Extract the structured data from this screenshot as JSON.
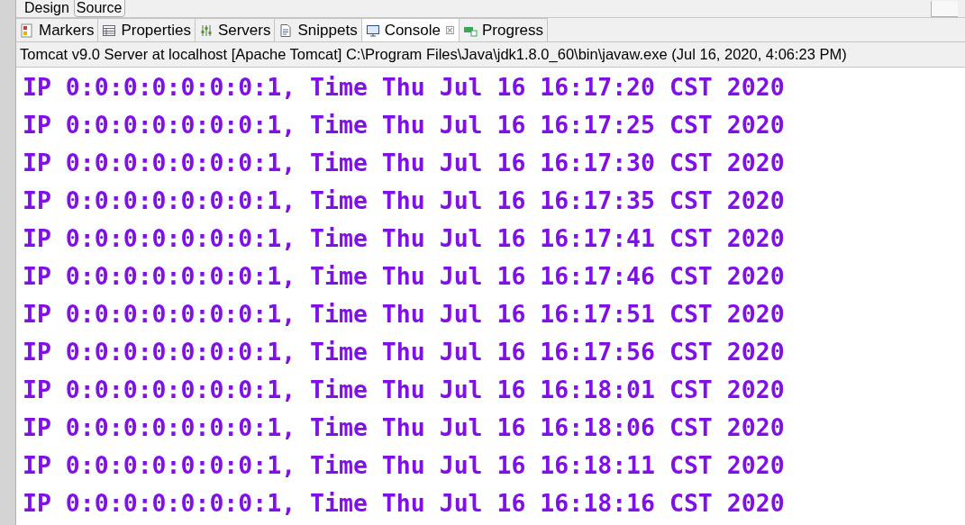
{
  "editor_tabs": [
    {
      "label": "Design",
      "selected": false
    },
    {
      "label": "Source",
      "selected": true
    }
  ],
  "view_tabs": [
    {
      "label": "Markers",
      "selected": false
    },
    {
      "label": "Properties",
      "selected": false
    },
    {
      "label": "Servers",
      "selected": false
    },
    {
      "label": "Snippets",
      "selected": false
    },
    {
      "label": "Console",
      "selected": true,
      "close": "☒"
    },
    {
      "label": "Progress",
      "selected": false
    }
  ],
  "console": {
    "process": "Tomcat v9.0 Server at localhost [Apache Tomcat] C:\\Program Files\\Java\\jdk1.8.0_60\\bin\\javaw.exe (Jul 16, 2020, 4:06:23 PM)",
    "lines": [
      "IP 0:0:0:0:0:0:0:1, Time Thu Jul 16 16:17:20 CST 2020",
      "IP 0:0:0:0:0:0:0:1, Time Thu Jul 16 16:17:25 CST 2020",
      "IP 0:0:0:0:0:0:0:1, Time Thu Jul 16 16:17:30 CST 2020",
      "IP 0:0:0:0:0:0:0:1, Time Thu Jul 16 16:17:35 CST 2020",
      "IP 0:0:0:0:0:0:0:1, Time Thu Jul 16 16:17:41 CST 2020",
      "IP 0:0:0:0:0:0:0:1, Time Thu Jul 16 16:17:46 CST 2020",
      "IP 0:0:0:0:0:0:0:1, Time Thu Jul 16 16:17:51 CST 2020",
      "IP 0:0:0:0:0:0:0:1, Time Thu Jul 16 16:17:56 CST 2020",
      "IP 0:0:0:0:0:0:0:1, Time Thu Jul 16 16:18:01 CST 2020",
      "IP 0:0:0:0:0:0:0:1, Time Thu Jul 16 16:18:06 CST 2020",
      "IP 0:0:0:0:0:0:0:1, Time Thu Jul 16 16:18:11 CST 2020",
      "IP 0:0:0:0:0:0:0:1, Time Thu Jul 16 16:18:16 CST 2020"
    ]
  }
}
